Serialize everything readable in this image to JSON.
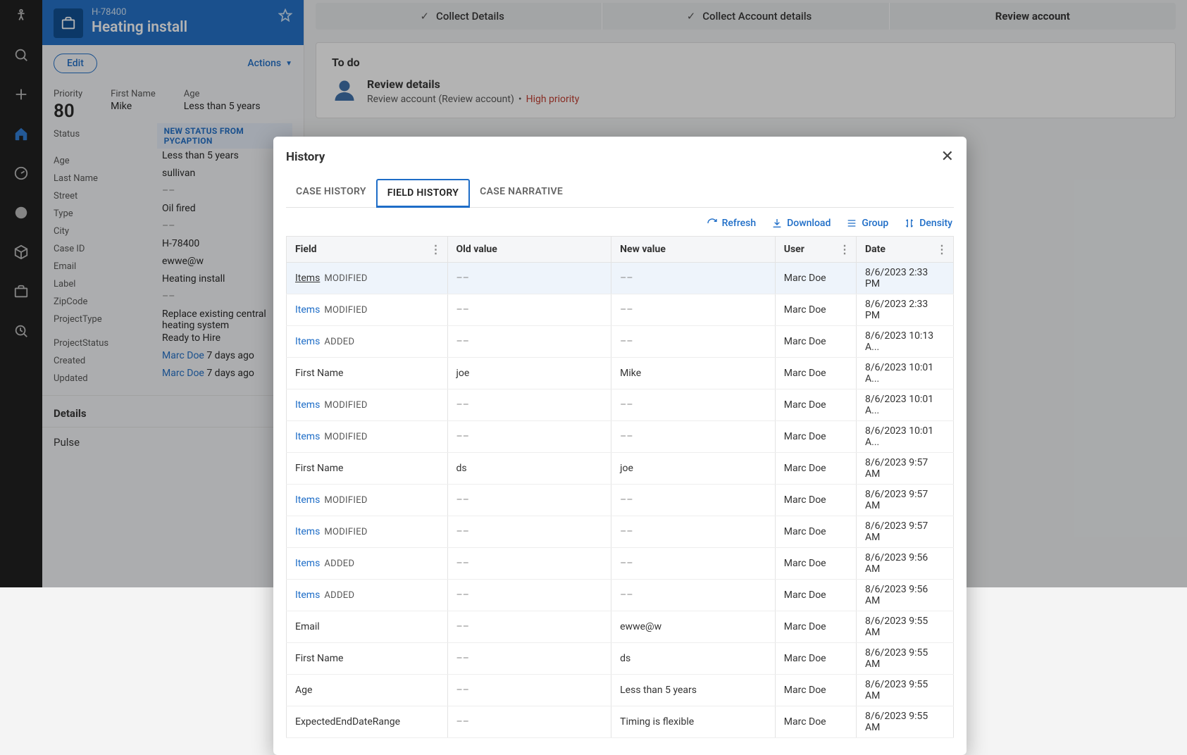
{
  "nav": {
    "icons": [
      "accessibility-icon",
      "search-icon",
      "plus-icon",
      "home-icon",
      "gauge-icon",
      "chat-icon",
      "cube-icon",
      "briefcase-icon",
      "analytics-icon"
    ]
  },
  "case": {
    "id": "H-78400",
    "title": "Heating install",
    "edit_label": "Edit",
    "actions_label": "Actions",
    "priority_label": "Priority",
    "priority_value": "80",
    "firstname_label": "First Name",
    "firstname_value": "Mike",
    "age_label": "Age",
    "age_value": "Less than 5 years",
    "status_label": "Status",
    "status_badge": "NEW STATUS FROM PYCAPTION",
    "age2_label": "Age",
    "age2_value": "Less than 5 years",
    "lastname_label": "Last Name",
    "lastname_value": "sullivan",
    "street_label": "Street",
    "street_value": "––",
    "type_label": "Type",
    "type_value": "Oil fired",
    "city_label": "City",
    "city_value": "––",
    "caseid_label": "Case ID",
    "caseid_value": "H-78400",
    "email_label": "Email",
    "email_value": "ewwe@w",
    "label_label": "Label",
    "label_value": "Heating install",
    "zip_label": "ZipCode",
    "zip_value": "––",
    "projtype_label": "ProjectType",
    "projtype_value": "Replace existing central heating system",
    "projstatus_label": "ProjectStatus",
    "projstatus_value": "Ready to Hire",
    "created_label": "Created",
    "created_user": "Marc Doe",
    "created_ago": " 7 days ago",
    "updated_label": "Updated",
    "updated_user": "Marc Doe",
    "updated_ago": " 7 days ago",
    "details_section": "Details",
    "pulse_section": "Pulse"
  },
  "stepper": {
    "step1": "Collect Details",
    "step2": "Collect Account details",
    "step3": "Review account"
  },
  "todo": {
    "heading": "To do",
    "title": "Review details",
    "subtitle": "Review account (Review account)",
    "priority": "High priority"
  },
  "modal": {
    "title": "History",
    "tab_case_history": "CASE HISTORY",
    "tab_field_history": "FIELD HISTORY",
    "tab_case_narrative": "CASE NARRATIVE",
    "tool_refresh": "Refresh",
    "tool_download": "Download",
    "tool_group": "Group",
    "tool_density": "Density",
    "col_field": "Field",
    "col_old": "Old value",
    "col_new": "New value",
    "col_user": "User",
    "col_date": "Date",
    "rows": [
      {
        "field": "Items",
        "link": true,
        "underline": true,
        "tag": "MODIFIED",
        "old": "––",
        "new": "––",
        "user": "Marc Doe",
        "date": "8/6/2023 2:33 PM"
      },
      {
        "field": "Items",
        "link": true,
        "tag": "MODIFIED",
        "old": "––",
        "new": "––",
        "user": "Marc Doe",
        "date": "8/6/2023 2:33 PM"
      },
      {
        "field": "Items",
        "link": true,
        "tag": "ADDED",
        "old": "––",
        "new": "––",
        "user": "Marc Doe",
        "date": "8/6/2023 10:13 A..."
      },
      {
        "field": "First Name",
        "link": false,
        "tag": "",
        "old": "joe",
        "new": "Mike",
        "user": "Marc Doe",
        "date": "8/6/2023 10:01 A..."
      },
      {
        "field": "Items",
        "link": true,
        "tag": "MODIFIED",
        "old": "––",
        "new": "––",
        "user": "Marc Doe",
        "date": "8/6/2023 10:01 A..."
      },
      {
        "field": "Items",
        "link": true,
        "tag": "MODIFIED",
        "old": "––",
        "new": "––",
        "user": "Marc Doe",
        "date": "8/6/2023 10:01 A..."
      },
      {
        "field": "First Name",
        "link": false,
        "tag": "",
        "old": "ds",
        "new": "joe",
        "user": "Marc Doe",
        "date": "8/6/2023 9:57 AM"
      },
      {
        "field": "Items",
        "link": true,
        "tag": "MODIFIED",
        "old": "––",
        "new": "––",
        "user": "Marc Doe",
        "date": "8/6/2023 9:57 AM"
      },
      {
        "field": "Items",
        "link": true,
        "tag": "MODIFIED",
        "old": "––",
        "new": "––",
        "user": "Marc Doe",
        "date": "8/6/2023 9:57 AM"
      },
      {
        "field": "Items",
        "link": true,
        "tag": "ADDED",
        "old": "––",
        "new": "––",
        "user": "Marc Doe",
        "date": "8/6/2023 9:56 AM"
      },
      {
        "field": "Items",
        "link": true,
        "tag": "ADDED",
        "old": "––",
        "new": "––",
        "user": "Marc Doe",
        "date": "8/6/2023 9:56 AM"
      },
      {
        "field": "Email",
        "link": false,
        "tag": "",
        "old": "––",
        "new": "ewwe@w",
        "user": "Marc Doe",
        "date": "8/6/2023 9:55 AM"
      },
      {
        "field": "First Name",
        "link": false,
        "tag": "",
        "old": "––",
        "new": "ds",
        "user": "Marc Doe",
        "date": "8/6/2023 9:55 AM"
      },
      {
        "field": "Age",
        "link": false,
        "tag": "",
        "old": "––",
        "new": "Less than 5 years",
        "user": "Marc Doe",
        "date": "8/6/2023 9:55 AM"
      },
      {
        "field": "ExpectedEndDateRange",
        "link": false,
        "tag": "",
        "old": "––",
        "new": "Timing is flexible",
        "user": "Marc Doe",
        "date": "8/6/2023 9:55 AM"
      }
    ]
  }
}
